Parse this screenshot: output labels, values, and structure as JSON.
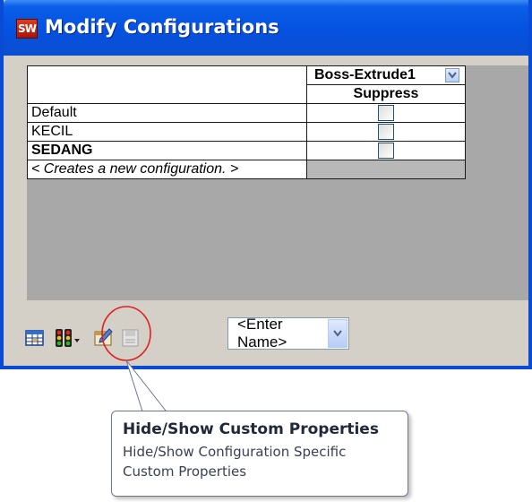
{
  "window": {
    "app_icon": "SW",
    "title": "Modify Configurations"
  },
  "table": {
    "column_header": "Boss-Extrude1",
    "sub_header": "Suppress",
    "rows": [
      {
        "label": "Default"
      },
      {
        "label": "KECIL"
      },
      {
        "label": "SEDANG"
      }
    ],
    "new_row_label": "< Creates a new configuration. >"
  },
  "toolbar": {
    "icons": [
      "table-view-icon",
      "traffic-light-icon",
      "custom-properties-icon",
      "save-table-icon"
    ],
    "name_field": "<Enter Name>"
  },
  "tooltip": {
    "title": "Hide/Show Custom Properties",
    "description_line1": "Hide/Show Configuration Specific",
    "description_line2": "Custom Properties"
  },
  "colors": {
    "titlebar": "#0551e0",
    "window_bg": "#d4d0c8",
    "highlight_circle": "#e02020"
  }
}
